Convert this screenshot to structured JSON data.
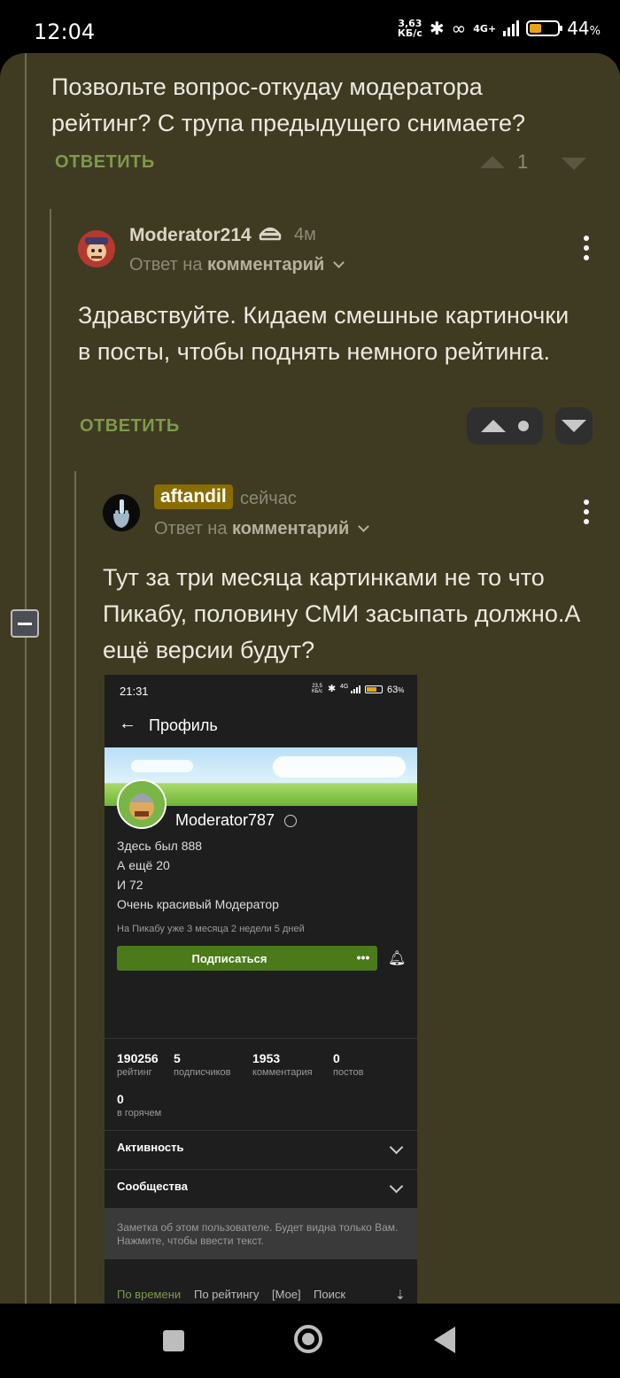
{
  "status_bar": {
    "time": "12:04",
    "net_speed_value": "3,63",
    "net_speed_unit": "КБ/с",
    "network_label": "4G+",
    "battery_percent": "44",
    "battery_percent_sign": "%",
    "battery_level": 0.44
  },
  "comment1": {
    "text": "Позвольте вопрос-откудау модератора рейтинг? С трупа предыдущего снимаете?",
    "reply_label": "ОТВЕТИТЬ",
    "score": "1"
  },
  "comment2": {
    "author": "Moderator214",
    "time_ago": "4м",
    "reply_to_prefix": "Ответ на",
    "reply_to_link": "комментарий",
    "text": "Здравствуйте. Кидаем смешные картиночки в посты, чтобы поднять немного рейтинга.",
    "reply_label": "ОТВЕТИТЬ"
  },
  "comment3": {
    "author": "aftandil",
    "time_ago": "сейчас",
    "reply_to_prefix": "Ответ на",
    "reply_to_link": "комментарий",
    "text": "Тут за три месяца картинками не то что Пикабу, половину СМИ засыпать должно.А ещё версии будут?"
  },
  "embedded_screenshot": {
    "status_time": "21:31",
    "status_speed": "23,5",
    "status_speed_unit": "КБ/с",
    "status_network": "4G",
    "status_battery": "63",
    "status_battery_sign": "%",
    "back_label": "←",
    "title": "Профиль",
    "username": "Moderator787",
    "bio_lines": [
      "Здесь был 888",
      "А ещё 20",
      "И 72",
      "Очень красивый Модератор"
    ],
    "on_site": "На Пикабу уже 3 месяца 2 недели 5 дней",
    "subscribe_label": "Подписаться",
    "more_label": "•••",
    "stats": [
      {
        "value": "190256",
        "label": "рейтинг"
      },
      {
        "value": "5",
        "label": "подписчиков"
      },
      {
        "value": "1953",
        "label": "комментария"
      },
      {
        "value": "0",
        "label": "постов"
      },
      {
        "value": "0",
        "label": "в горячем"
      }
    ],
    "sections": [
      "Активность",
      "Сообщества"
    ],
    "note": "Заметка об этом пользователе. Будет видна только Вам. Нажмите, чтобы ввести текст.",
    "tabs": [
      "По времени",
      "По рейтингу",
      "[Мое]",
      "Поиск"
    ],
    "active_tab": "По времени"
  },
  "colors": {
    "background": "#3f3a22",
    "accent_green": "#7e9a4a",
    "author_highlight": "#8a6d00"
  }
}
